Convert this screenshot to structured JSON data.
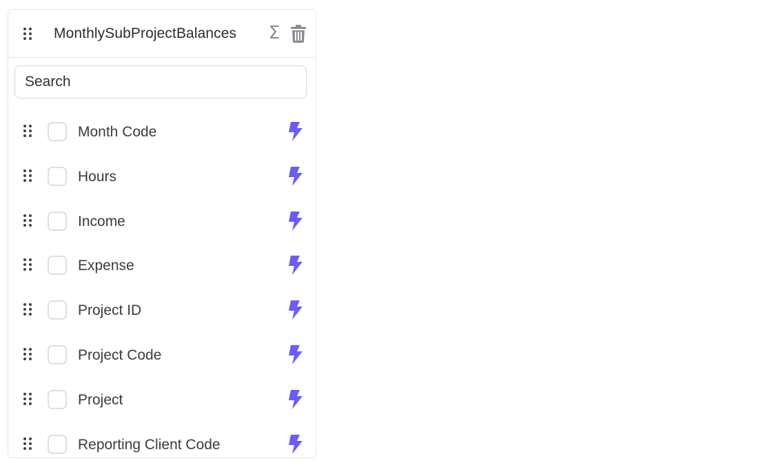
{
  "panel": {
    "title": "MonthlySubProjectBalances",
    "header_icons": [
      "drag-handle-icon",
      "sigma-icon",
      "trash-icon"
    ],
    "sum_symbol": "Σ"
  },
  "search": {
    "placeholder": "Search",
    "value": ""
  },
  "fields": [
    {
      "label": "Month Code",
      "checked": false
    },
    {
      "label": "Hours",
      "checked": false
    },
    {
      "label": "Income",
      "checked": false
    },
    {
      "label": "Expense",
      "checked": false
    },
    {
      "label": "Project ID",
      "checked": false
    },
    {
      "label": "Project Code",
      "checked": false
    },
    {
      "label": "Project",
      "checked": false
    },
    {
      "label": "Reporting Client Code",
      "checked": false
    }
  ],
  "colors": {
    "accent": "#6b5cf6",
    "icon_gray": "#8a8a92",
    "border": "#e6e6ea"
  }
}
